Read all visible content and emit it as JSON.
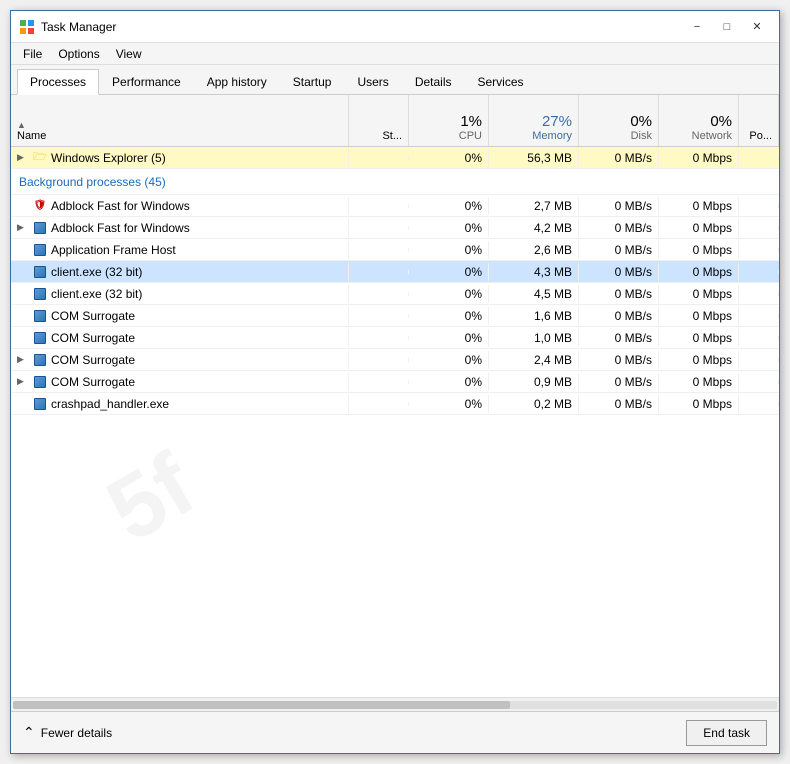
{
  "window": {
    "title": "Task Manager",
    "minimize_label": "−",
    "maximize_label": "□",
    "close_label": "✕"
  },
  "menu": {
    "items": [
      "File",
      "Options",
      "View"
    ]
  },
  "tabs": [
    {
      "label": "Processes",
      "active": true
    },
    {
      "label": "Performance",
      "active": false
    },
    {
      "label": "App history",
      "active": false
    },
    {
      "label": "Startup",
      "active": false
    },
    {
      "label": "Users",
      "active": false
    },
    {
      "label": "Details",
      "active": false
    },
    {
      "label": "Services",
      "active": false
    }
  ],
  "columns": {
    "name": "Name",
    "status": "St...",
    "cpu": {
      "pct": "1%",
      "label": "CPU"
    },
    "memory": {
      "pct": "27%",
      "label": "Memory"
    },
    "disk": {
      "pct": "0%",
      "label": "Disk"
    },
    "network": {
      "pct": "0%",
      "label": "Network"
    },
    "power": "Po..."
  },
  "windows_processes": {
    "title": "",
    "rows": [
      {
        "name": "Windows Explorer (5)",
        "status": "",
        "cpu": "0%",
        "memory": "56,3 MB",
        "disk": "0 MB/s",
        "network": "0 Mbps",
        "expandable": true,
        "icon": "folder",
        "heat": "mem2",
        "selected": false
      }
    ]
  },
  "background_section": {
    "title": "Background processes (45)",
    "rows": [
      {
        "name": "Adblock Fast for Windows",
        "status": "",
        "cpu": "0%",
        "memory": "2,7 MB",
        "disk": "0 MB/s",
        "network": "0 Mbps",
        "icon": "adblock",
        "expandable": false,
        "heat": "",
        "selected": false
      },
      {
        "name": "Adblock Fast for Windows",
        "status": "",
        "cpu": "0%",
        "memory": "4,2 MB",
        "disk": "0 MB/s",
        "network": "0 Mbps",
        "icon": "generic",
        "expandable": true,
        "heat": "",
        "selected": false
      },
      {
        "name": "Application Frame Host",
        "status": "",
        "cpu": "0%",
        "memory": "2,6 MB",
        "disk": "0 MB/s",
        "network": "0 Mbps",
        "icon": "generic",
        "expandable": false,
        "heat": "",
        "selected": false
      },
      {
        "name": "client.exe (32 bit)",
        "status": "",
        "cpu": "0%",
        "memory": "4,3 MB",
        "disk": "0 MB/s",
        "network": "0 Mbps",
        "icon": "generic",
        "expandable": false,
        "heat": "",
        "selected": true
      },
      {
        "name": "client.exe (32 bit)",
        "status": "",
        "cpu": "0%",
        "memory": "4,5 MB",
        "disk": "0 MB/s",
        "network": "0 Mbps",
        "icon": "generic",
        "expandable": false,
        "heat": "",
        "selected": false
      },
      {
        "name": "COM Surrogate",
        "status": "",
        "cpu": "0%",
        "memory": "1,6 MB",
        "disk": "0 MB/s",
        "network": "0 Mbps",
        "icon": "generic",
        "expandable": false,
        "heat": "",
        "selected": false
      },
      {
        "name": "COM Surrogate",
        "status": "",
        "cpu": "0%",
        "memory": "1,0 MB",
        "disk": "0 MB/s",
        "network": "0 Mbps",
        "icon": "generic",
        "expandable": false,
        "heat": "",
        "selected": false
      },
      {
        "name": "COM Surrogate",
        "status": "",
        "cpu": "0%",
        "memory": "2,4 MB",
        "disk": "0 MB/s",
        "network": "0 Mbps",
        "icon": "generic",
        "expandable": true,
        "heat": "",
        "selected": false
      },
      {
        "name": "COM Surrogate",
        "status": "",
        "cpu": "0%",
        "memory": "0,9 MB",
        "disk": "0 MB/s",
        "network": "0 Mbps",
        "icon": "generic",
        "expandable": true,
        "heat": "",
        "selected": false
      },
      {
        "name": "crashpad_handler.exe",
        "status": "",
        "cpu": "0%",
        "memory": "0,2 MB",
        "disk": "0 MB/s",
        "network": "0 Mbps",
        "icon": "generic",
        "expandable": false,
        "heat": "",
        "selected": false
      }
    ]
  },
  "footer": {
    "fewer_details_label": "Fewer details",
    "end_task_label": "End task"
  }
}
